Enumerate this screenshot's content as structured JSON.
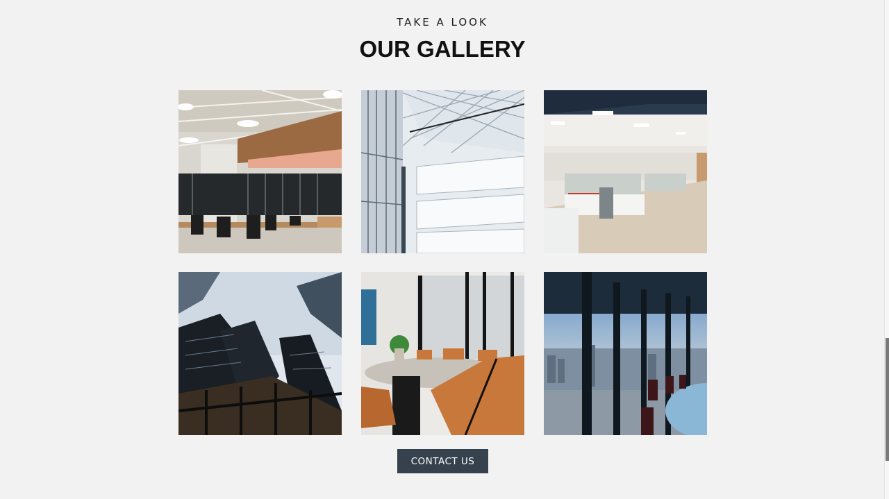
{
  "section": {
    "eyebrow": "TAKE A LOOK",
    "title": "OUR GALLERY"
  },
  "gallery": {
    "images": [
      {
        "name": "open-office-interior"
      },
      {
        "name": "glass-atrium"
      },
      {
        "name": "cubicle-workspace"
      },
      {
        "name": "skyscrapers-view"
      },
      {
        "name": "meeting-room"
      },
      {
        "name": "city-view-window"
      }
    ]
  },
  "cta": {
    "label": "CONTACT US",
    "background": "#35414d"
  }
}
